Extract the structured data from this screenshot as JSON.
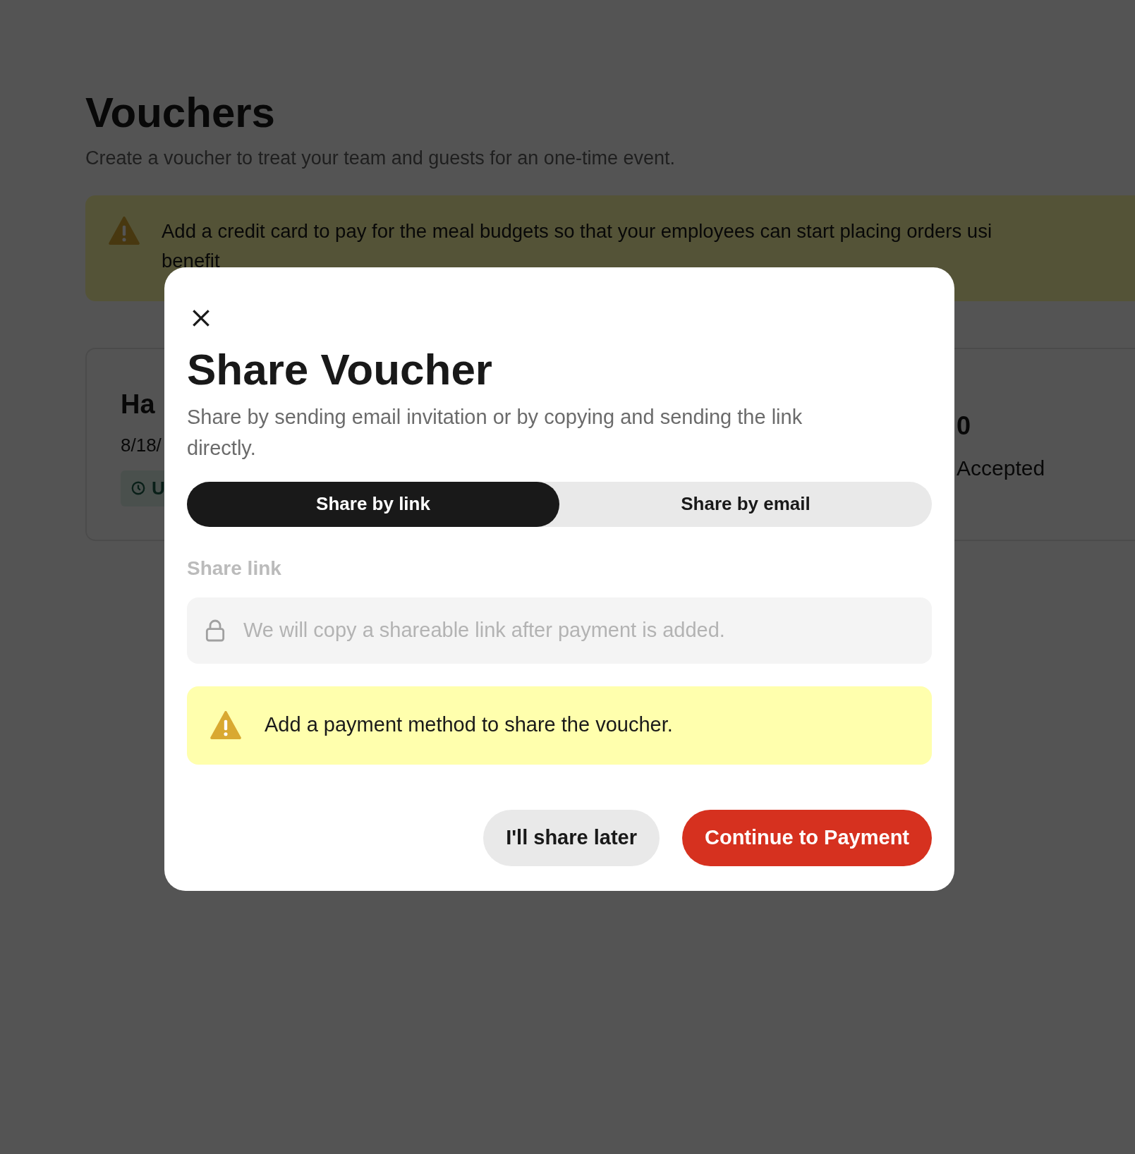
{
  "page": {
    "title": "Vouchers",
    "subtitle": "Create a voucher to treat your team and guests for an one-time event.",
    "banner": {
      "lines": [
        "Add a credit card to pay for the meal budgets so that your employees can start placing orders usi",
        "benefit"
      ]
    },
    "voucher_card": {
      "name": "Ha",
      "date": "8/18/",
      "status": "U",
      "count": "0",
      "count_label": "Accepted"
    }
  },
  "dialog": {
    "title": "Share Voucher",
    "description": "Share by sending email invitation or by copying and sending the link directly.",
    "tabs": [
      {
        "label": "Share by link",
        "selected": true
      },
      {
        "label": "Share by email",
        "selected": false
      }
    ],
    "field_label": "Share link",
    "link_field": {
      "placeholder": "We will copy a shareable link after payment is added."
    },
    "alert": "Add a payment method to share the voucher.",
    "buttons": [
      {
        "label": "I'll share later",
        "kind": "secondary"
      },
      {
        "label": "Continue to Payment",
        "kind": "primary"
      }
    ]
  }
}
